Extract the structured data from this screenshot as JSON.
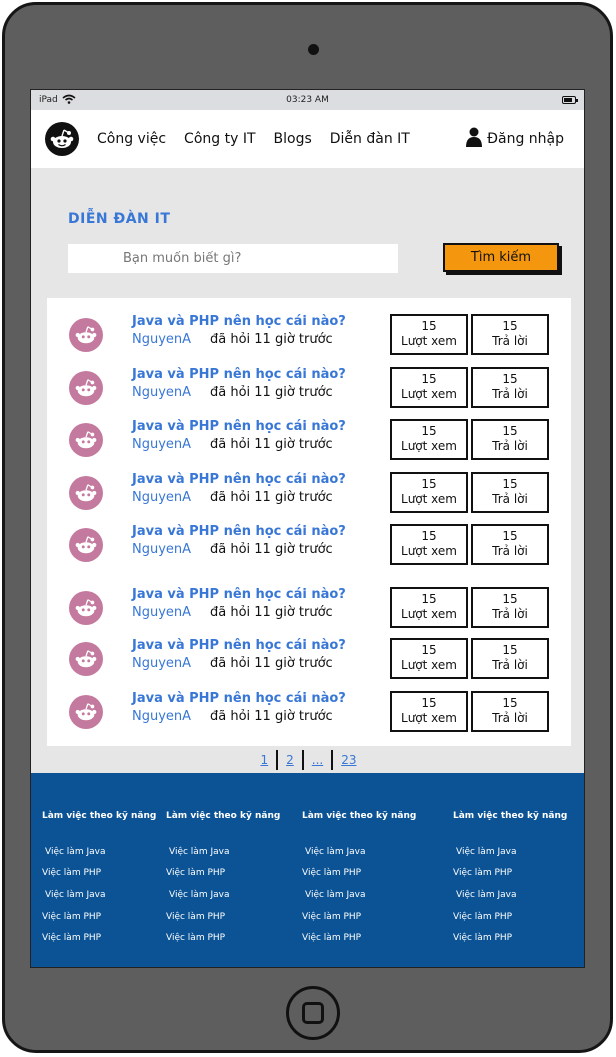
{
  "statusbar": {
    "device": "iPad",
    "time": "03:23 AM"
  },
  "nav": {
    "links": [
      "Công việc",
      "Công ty IT",
      "Blogs",
      "Diễn đàn IT"
    ],
    "login": "Đăng nhập"
  },
  "forum": {
    "title": "DIỄN ĐÀN IT",
    "search_placeholder": "Bạn muốn biết gì?",
    "search_button": "Tìm kiếm"
  },
  "questions": [
    {
      "title": "Java và PHP nên học cái nào?",
      "author": "NguyenA",
      "time": "đã hỏi 11 giờ trước",
      "views": "15",
      "views_label": "Lượt xem",
      "replies": "15",
      "replies_label": "Trả lời"
    },
    {
      "title": "Java và PHP nên học cái nào?",
      "author": "NguyenA",
      "time": "đã hỏi 11 giờ trước",
      "views": "15",
      "views_label": "Lượt xem",
      "replies": "15",
      "replies_label": "Trả lời"
    },
    {
      "title": "Java và PHP nên học cái nào?",
      "author": "NguyenA",
      "time": "đã hỏi 11 giờ trước",
      "views": "15",
      "views_label": "Lượt xem",
      "replies": "15",
      "replies_label": "Trả lời"
    },
    {
      "title": "Java và PHP nên học cái nào?",
      "author": "NguyenA",
      "time": "đã hỏi 11 giờ trước",
      "views": "15",
      "views_label": "Lượt xem",
      "replies": "15",
      "replies_label": "Trả lời"
    },
    {
      "title": "Java và PHP nên học cái nào?",
      "author": "NguyenA",
      "time": "đã hỏi 11 giờ trước",
      "views": "15",
      "views_label": "Lượt xem",
      "replies": "15",
      "replies_label": "Trả lời"
    },
    {
      "title": "Java và PHP nên học cái nào?",
      "author": "NguyenA",
      "time": "đã hỏi 11 giờ trước",
      "views": "15",
      "views_label": "Lượt xem",
      "replies": "15",
      "replies_label": "Trả lời"
    },
    {
      "title": "Java và PHP nên học cái nào?",
      "author": "NguyenA",
      "time": "đã hỏi 11 giờ trước",
      "views": "15",
      "views_label": "Lượt xem",
      "replies": "15",
      "replies_label": "Trả lời"
    },
    {
      "title": "Java và PHP nên học cái nào?",
      "author": "NguyenA",
      "time": "đã hỏi 11 giờ trước",
      "views": "15",
      "views_label": "Lượt xem",
      "replies": "15",
      "replies_label": "Trả lời"
    }
  ],
  "pagination": [
    "1",
    "2",
    "...",
    "23"
  ],
  "footer": {
    "columns": [
      {
        "heading": "Làm việc theo kỹ năng",
        "items": [
          "Việc làm Java",
          "Việc làm PHP",
          "Việc làm Java",
          "Việc làm PHP",
          "Việc làm PHP"
        ]
      },
      {
        "heading": "Làm việc theo kỹ năng",
        "items": [
          "Việc làm Java",
          "Việc làm PHP",
          "Việc làm Java",
          "Việc làm PHP",
          "Việc làm PHP"
        ]
      },
      {
        "heading": "Làm việc theo kỹ năng",
        "items": [
          "Việc làm Java",
          "Việc làm PHP",
          "Việc làm Java",
          "Việc làm PHP",
          "Việc làm PHP"
        ]
      },
      {
        "heading": "Làm việc theo kỹ năng",
        "items": [
          "Việc làm Java",
          "Việc làm PHP",
          "Việc làm Java",
          "Việc làm PHP",
          "Việc làm PHP"
        ]
      }
    ]
  },
  "colors": {
    "accent": "#3877d6",
    "button": "#f5960f",
    "footer": "#0b5394",
    "avatar": "#c47a9e"
  }
}
